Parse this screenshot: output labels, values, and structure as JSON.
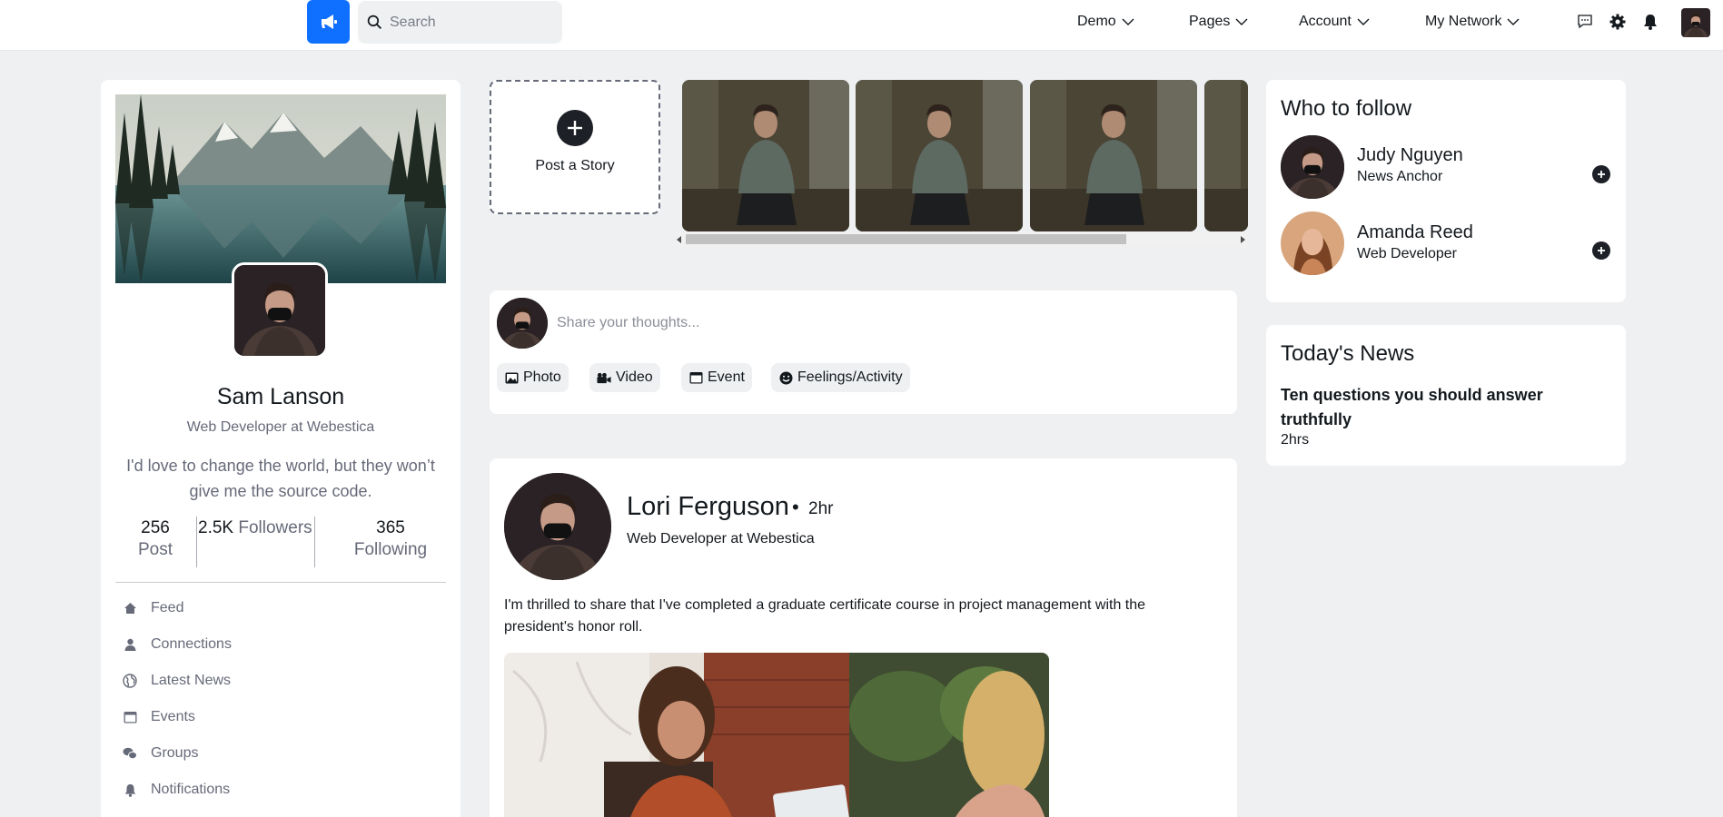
{
  "nav": {
    "search_placeholder": "Search",
    "menus": [
      "Demo",
      "Pages",
      "Account",
      "My Network"
    ],
    "icons": [
      "chat-icon",
      "gear-icon",
      "bell-icon"
    ],
    "brand_color": "#0f6fff"
  },
  "profile": {
    "name": "Sam Lanson",
    "role": "Web Developer at Webestica",
    "bio": "I'd love to change the world, but they won’t give me the source code.",
    "stats": [
      {
        "num": "256",
        "label": "Post"
      },
      {
        "num": "2.5K",
        "label": "Followers"
      },
      {
        "num": "365",
        "label": "Following"
      }
    ],
    "menu": [
      "Feed",
      "Connections",
      "Latest News",
      "Events",
      "Groups",
      "Notifications"
    ]
  },
  "stories": {
    "post_label": "Post a Story"
  },
  "composer": {
    "placeholder": "Share your thoughts...",
    "actions": [
      "Photo",
      "Video",
      "Event",
      "Feelings/Activity"
    ]
  },
  "post": {
    "author": "Lori Ferguson",
    "time": "2hr",
    "role": "Web Developer at Webestica",
    "text": "I'm thrilled to share that I've completed a graduate certificate course in project management with the president's honor roll."
  },
  "who_to_follow": {
    "title": "Who to follow",
    "people": [
      {
        "name": "Judy Nguyen",
        "role": "News Anchor"
      },
      {
        "name": "Amanda Reed",
        "role": "Web Developer"
      }
    ]
  },
  "news": {
    "title": "Today's News",
    "headline": "Ten questions you should answer truthfully",
    "time": "2hrs"
  }
}
